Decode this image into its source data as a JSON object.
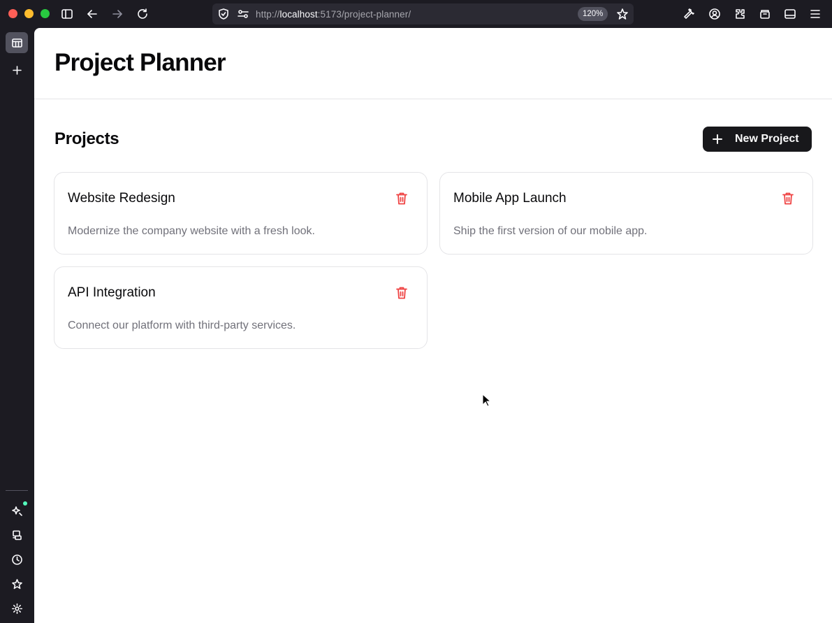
{
  "browser": {
    "url_prefix": "http://",
    "url_host": "localhost",
    "url_path": ":5173/project-planner/",
    "zoom": "120%"
  },
  "app": {
    "title": "Project Planner"
  },
  "projects_section": {
    "title": "Projects",
    "new_button_label": "New Project"
  },
  "projects": [
    {
      "title": "Website Redesign",
      "description": "Modernize the company website with a fresh look."
    },
    {
      "title": "Mobile App Launch",
      "description": "Ship the first version of our mobile app."
    },
    {
      "title": "API Integration",
      "description": "Connect our platform with third-party services."
    }
  ],
  "icons": {
    "delete": "trash-icon",
    "add": "plus-icon"
  },
  "colors": {
    "danger": "#ef4444",
    "primary_button": "#18181b",
    "muted_text": "#71717a"
  }
}
